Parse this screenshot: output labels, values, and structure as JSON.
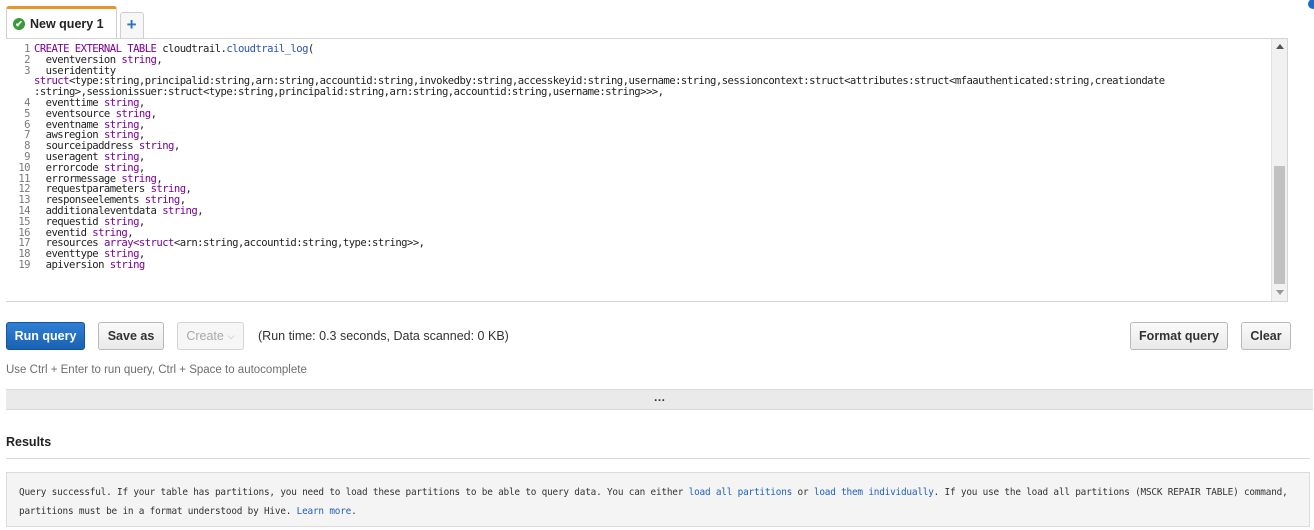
{
  "tabs": [
    {
      "label": "New query 1",
      "active": true
    }
  ],
  "editor": {
    "lines": [
      {
        "n": "1",
        "segs": [
          {
            "t": "CREATE EXTERNAL TABLE",
            "c": "kw"
          },
          {
            "t": " cloudtrail.",
            "c": ""
          },
          {
            "t": "cloudtrail_log",
            "c": "tbl"
          },
          {
            "t": "(",
            "c": ""
          }
        ]
      },
      {
        "n": "2",
        "segs": [
          {
            "t": "  eventversion ",
            "c": ""
          },
          {
            "t": "string",
            "c": "ty"
          },
          {
            "t": ",",
            "c": ""
          }
        ]
      },
      {
        "n": "3",
        "segs": [
          {
            "t": "  useridentity",
            "c": ""
          }
        ]
      },
      {
        "n": "",
        "segs": [
          {
            "t": "struct",
            "c": "ty"
          },
          {
            "t": "<type:string,principalid:string,arn:string,accountid:string,invokedby:string,accesskeyid:string,username:string,sessioncontext:struct<attributes:struct<mfaauthenticated:string,creationdate",
            "c": ""
          }
        ]
      },
      {
        "n": "",
        "segs": [
          {
            "t": ":string>,sessionissuer:struct<type:string,principalid:string,arn:string,accountid:string,username:string>>>,",
            "c": ""
          }
        ]
      },
      {
        "n": "4",
        "segs": [
          {
            "t": "  eventtime ",
            "c": ""
          },
          {
            "t": "string",
            "c": "ty"
          },
          {
            "t": ",",
            "c": ""
          }
        ]
      },
      {
        "n": "5",
        "segs": [
          {
            "t": "  eventsource ",
            "c": ""
          },
          {
            "t": "string",
            "c": "ty"
          },
          {
            "t": ",",
            "c": ""
          }
        ]
      },
      {
        "n": "6",
        "segs": [
          {
            "t": "  eventname ",
            "c": ""
          },
          {
            "t": "string",
            "c": "ty"
          },
          {
            "t": ",",
            "c": ""
          }
        ]
      },
      {
        "n": "7",
        "segs": [
          {
            "t": "  awsregion ",
            "c": ""
          },
          {
            "t": "string",
            "c": "ty"
          },
          {
            "t": ",",
            "c": ""
          }
        ]
      },
      {
        "n": "8",
        "segs": [
          {
            "t": "  sourceipaddress ",
            "c": ""
          },
          {
            "t": "string",
            "c": "ty"
          },
          {
            "t": ",",
            "c": ""
          }
        ]
      },
      {
        "n": "9",
        "segs": [
          {
            "t": "  useragent ",
            "c": ""
          },
          {
            "t": "string",
            "c": "ty"
          },
          {
            "t": ",",
            "c": ""
          }
        ]
      },
      {
        "n": "10",
        "segs": [
          {
            "t": "  errorcode ",
            "c": ""
          },
          {
            "t": "string",
            "c": "ty"
          },
          {
            "t": ",",
            "c": ""
          }
        ]
      },
      {
        "n": "11",
        "segs": [
          {
            "t": "  errormessage ",
            "c": ""
          },
          {
            "t": "string",
            "c": "ty"
          },
          {
            "t": ",",
            "c": ""
          }
        ]
      },
      {
        "n": "12",
        "segs": [
          {
            "t": "  requestparameters ",
            "c": ""
          },
          {
            "t": "string",
            "c": "ty"
          },
          {
            "t": ",",
            "c": ""
          }
        ]
      },
      {
        "n": "13",
        "segs": [
          {
            "t": "  responseelements ",
            "c": ""
          },
          {
            "t": "string",
            "c": "ty"
          },
          {
            "t": ",",
            "c": ""
          }
        ]
      },
      {
        "n": "14",
        "segs": [
          {
            "t": "  additionaleventdata ",
            "c": ""
          },
          {
            "t": "string",
            "c": "ty"
          },
          {
            "t": ",",
            "c": ""
          }
        ]
      },
      {
        "n": "15",
        "segs": [
          {
            "t": "  requestid ",
            "c": ""
          },
          {
            "t": "string",
            "c": "ty"
          },
          {
            "t": ",",
            "c": ""
          }
        ]
      },
      {
        "n": "16",
        "segs": [
          {
            "t": "  eventid ",
            "c": ""
          },
          {
            "t": "string",
            "c": "ty"
          },
          {
            "t": ",",
            "c": ""
          }
        ]
      },
      {
        "n": "17",
        "segs": [
          {
            "t": "  resources ",
            "c": ""
          },
          {
            "t": "array<struct",
            "c": "ty"
          },
          {
            "t": "<arn:string,accountid:string,type:string>>,",
            "c": ""
          }
        ]
      },
      {
        "n": "18",
        "segs": [
          {
            "t": "  eventtype ",
            "c": ""
          },
          {
            "t": "string",
            "c": "ty"
          },
          {
            "t": ",",
            "c": ""
          }
        ]
      },
      {
        "n": "19",
        "segs": [
          {
            "t": "  apiversion ",
            "c": ""
          },
          {
            "t": "string",
            "c": "ty"
          }
        ]
      }
    ]
  },
  "toolbar": {
    "run_label": "Run query",
    "save_label": "Save as",
    "create_label": "Create",
    "runtime_text": "(Run time: 0.3 seconds, Data scanned: 0 KB)",
    "format_label": "Format query",
    "clear_label": "Clear"
  },
  "hint": "Use Ctrl + Enter to run query, Ctrl + Space to autocomplete",
  "splitter": "…",
  "results": {
    "title": "Results",
    "msg_1": "Query successful. If your table has partitions, you need to load these partitions to be able to query data. You can either ",
    "link_load_all": "load all partitions",
    "msg_2": " or ",
    "link_individually": "load them individually",
    "msg_3": ". If you use the load all partitions (MSCK REPAIR TABLE) command, partitions must be in a format understood by Hive. ",
    "link_learn": "Learn more",
    "msg_4": "."
  },
  "colors": {
    "tab_accent": "#e8962a",
    "primary_button": "#1a62b3",
    "keyword": "#7a0099",
    "link": "#1f5fbf"
  }
}
